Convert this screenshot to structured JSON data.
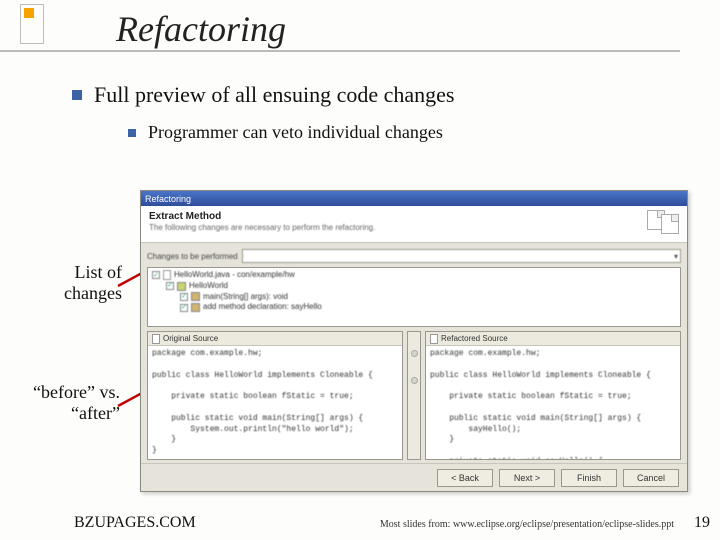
{
  "title": "Refactoring",
  "bullets": {
    "main": "Full preview of all ensuing code changes",
    "sub": "Programmer can veto individual changes"
  },
  "callouts": {
    "list": "List of\nchanges",
    "diff": "“before” vs.\n“after”"
  },
  "dialog": {
    "window_title": "Refactoring",
    "header_title": "Extract Method",
    "header_sub": "The following changes are necessary to perform the refactoring.",
    "file_label": "Changes to be performed",
    "file_value": "",
    "tree": {
      "l1": "HelloWorld.java - con/example/hw",
      "l2": "HelloWorld",
      "l3a": "main(String[] args): void",
      "l3b": "add method declaration: sayHello"
    },
    "left_header": "Original Source",
    "right_header": "Refactored Source",
    "code_left": "package com.example.hw;\n\npublic class HelloWorld implements Cloneable {\n\n    private static boolean fStatic = true;\n\n    public static void main(String[] args) {\n        System.out.println(\"hello world\");\n    }\n}",
    "code_right": "package com.example.hw;\n\npublic class HelloWorld implements Cloneable {\n\n    private static boolean fStatic = true;\n\n    public static void main(String[] args) {\n        sayHello();\n    }\n\n    private static void sayHello() {\n",
    "buttons": {
      "back": "< Back",
      "next": "Next >",
      "finish": "Finish",
      "cancel": "Cancel"
    }
  },
  "footer": {
    "left": "BZUPAGES.COM",
    "right": "Most slides from: www.eclipse.org/eclipse/presentation/eclipse-slides.ppt",
    "page": "19"
  }
}
